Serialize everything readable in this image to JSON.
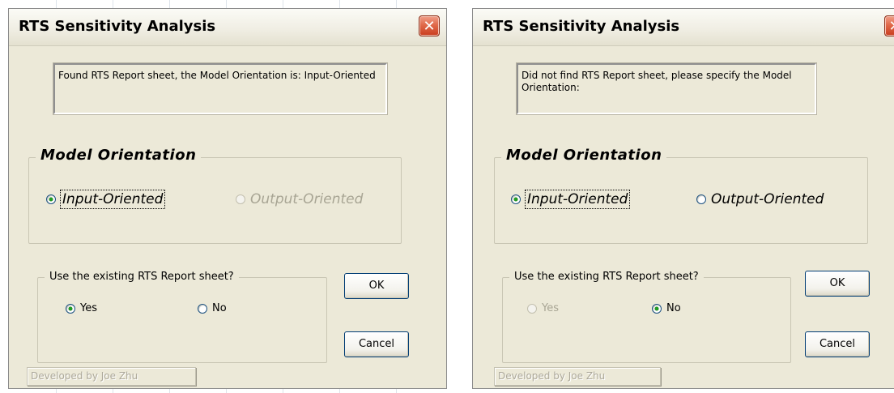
{
  "dialogs": [
    {
      "title": "RTS Sensitivity Analysis",
      "status_text": "Found RTS Report sheet, the Model Orientation is: Input-Oriented",
      "model_group_label": "Model Orientation",
      "orientation": {
        "input_label": "Input-Oriented",
        "output_label": "Output-Oriented",
        "selected": "Input-Oriented",
        "output_enabled": false
      },
      "use_group_label": "Use the existing RTS Report sheet?",
      "use_existing": {
        "yes_label": "Yes",
        "no_label": "No",
        "selected": "Yes",
        "yes_enabled": true
      },
      "ok_label": "OK",
      "cancel_label": "Cancel",
      "developer_label": "Developed by Joe Zhu"
    },
    {
      "title": "RTS Sensitivity Analysis",
      "status_text": "Did not find RTS Report sheet, please specify the Model Orientation:",
      "model_group_label": "Model Orientation",
      "orientation": {
        "input_label": "Input-Oriented",
        "output_label": "Output-Oriented",
        "selected": "Input-Oriented",
        "output_enabled": true
      },
      "use_group_label": "Use the existing RTS Report sheet?",
      "use_existing": {
        "yes_label": "Yes",
        "no_label": "No",
        "selected": "No",
        "yes_enabled": false
      },
      "ok_label": "OK",
      "cancel_label": "Cancel",
      "developer_label": "Developed by Joe Zhu"
    }
  ],
  "icons": {
    "close": "close-icon",
    "radio": "radio-button-icon"
  },
  "colors": {
    "dialog_bg": "#ece9d8",
    "close_button": "#e06a4a",
    "button_border": "#003c74",
    "disabled_text": "#a8a594"
  }
}
